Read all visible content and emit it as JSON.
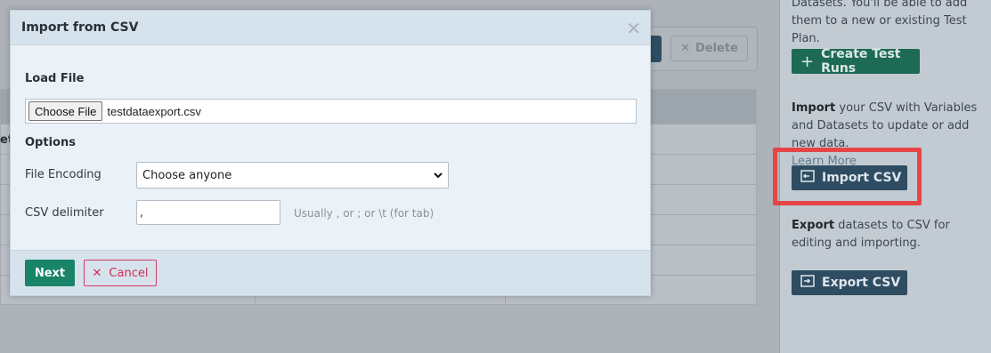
{
  "background": {
    "delete_label": "Delete",
    "delete_icon": "close-icon",
    "cut_text": "et"
  },
  "sidebar": {
    "intro_text": "Datasets. You'll be able to add them to a new or existing Test Plan.",
    "create_runs_label": "Create Test Runs",
    "import_bold": "Import",
    "import_text": " your CSV with Variables and Datasets to update or add new data.",
    "learn_more": "Learn More",
    "import_csv_label": "Import CSV",
    "export_bold": "Export",
    "export_text": " datasets to CSV for editing and importing.",
    "export_csv_label": "Export CSV",
    "accent_color": "#2f4d62",
    "highlight_color": "#e74545"
  },
  "modal": {
    "title": "Import from CSV",
    "close_icon": "close-icon",
    "load_file_label": "Load File",
    "choose_file_label": "Choose File",
    "file_name": "testdataexport.csv",
    "options_label": "Options",
    "encoding_label": "File Encoding",
    "encoding_value": "Choose anyone",
    "delimiter_label": "CSV delimiter",
    "delimiter_value": ",",
    "delimiter_hint": "Usually , or ; or \\t (for tab)",
    "next_label": "Next",
    "cancel_label": "Cancel",
    "next_color": "#198468",
    "cancel_color": "#cf2e5a"
  }
}
